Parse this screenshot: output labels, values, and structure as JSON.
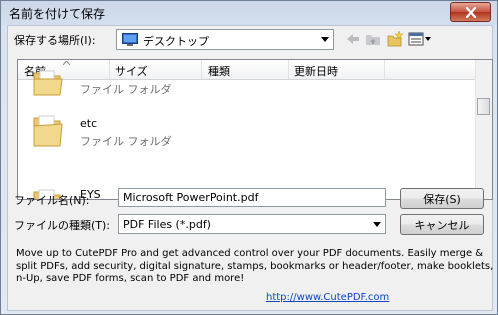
{
  "window": {
    "title": "名前を付けて保存",
    "close_icon": "close-icon"
  },
  "save_in": {
    "label": "保存する場所(I):",
    "value": "デスクトップ"
  },
  "toolbar": {
    "back_icon": "back-arrow-icon",
    "up_icon": "up-folder-icon",
    "new_folder_icon": "new-folder-icon",
    "view_icon": "view-menu-icon"
  },
  "columns": [
    "名前",
    "サイズ",
    "種類",
    "更新日時"
  ],
  "files": [
    {
      "name": "",
      "type": "ファイル フォルダ"
    },
    {
      "name": "etc",
      "type": "ファイル フォルダ"
    },
    {
      "name": "EYS",
      "type": ""
    }
  ],
  "filename": {
    "label": "ファイル名(N):",
    "value": "Microsoft PowerPoint.pdf"
  },
  "filetype": {
    "label": "ファイルの種類(T):",
    "value": "PDF Files (*.pdf)"
  },
  "buttons": {
    "save": "保存(S)",
    "cancel": "キャンセル"
  },
  "promo": {
    "text": "Move up to CutePDF Pro and get advanced control over your PDF documents. Easily merge & split PDFs, add security, digital signature, stamps, bookmarks or header/footer, make booklets, n-Up, save PDF forms, scan to PDF and more!",
    "link": "http://www.CutePDF.com"
  }
}
